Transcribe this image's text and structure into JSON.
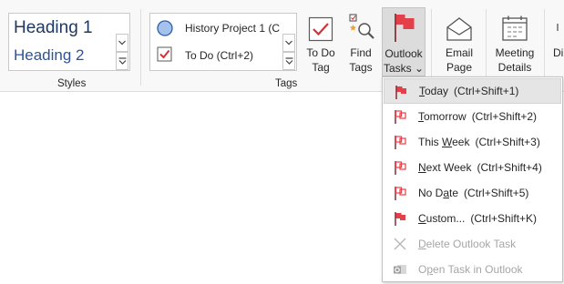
{
  "styles": {
    "heading1": "Heading 1",
    "heading2": "Heading 2",
    "group_label": "Styles"
  },
  "tags": {
    "items": [
      {
        "label": "History Project 1 (C",
        "icon": "circle-icon"
      },
      {
        "label": "To Do (Ctrl+2)",
        "icon": "checkbox-icon"
      }
    ],
    "group_label": "Tags"
  },
  "buttons": {
    "todo_tag": {
      "line1": "To Do",
      "line2": "Tag"
    },
    "find_tags": {
      "line1": "Find",
      "line2": "Tags"
    },
    "outlook_tasks": {
      "line1": "Outlook",
      "line2": "Tasks ⌄"
    },
    "email_page": {
      "line1": "Email",
      "line2": "Page"
    },
    "meeting_details": {
      "line1": "Meeting",
      "line2": "Details"
    },
    "partial": "Di"
  },
  "menu": {
    "items": [
      {
        "pre": "",
        "ul": "T",
        "post": "oday",
        "shortcut": "(Ctrl+Shift+1)",
        "icon": "red-flag-icon",
        "disabled": false
      },
      {
        "pre": "",
        "ul": "T",
        "post": "omorrow",
        "shortcut": "(Ctrl+Shift+2)",
        "icon": "red-flag-icon",
        "disabled": false
      },
      {
        "pre": "This ",
        "ul": "W",
        "post": "eek",
        "shortcut": "(Ctrl+Shift+3)",
        "icon": "red-flag-icon",
        "disabled": false
      },
      {
        "pre": "",
        "ul": "N",
        "post": "ext Week",
        "shortcut": "(Ctrl+Shift+4)",
        "icon": "red-flag-icon",
        "disabled": false
      },
      {
        "pre": "No D",
        "ul": "a",
        "post": "te",
        "shortcut": "(Ctrl+Shift+5)",
        "icon": "red-flag-icon",
        "disabled": false
      },
      {
        "pre": "",
        "ul": "C",
        "post": "ustom...",
        "shortcut": "(Ctrl+Shift+K)",
        "icon": "red-flag-icon",
        "disabled": false
      },
      {
        "pre": "",
        "ul": "D",
        "post": "elete Outlook Task",
        "shortcut": "",
        "icon": "delete-x-icon",
        "disabled": true
      },
      {
        "pre": "O",
        "ul": "p",
        "post": "en Task in Outlook",
        "shortcut": "",
        "icon": "outlook-icon",
        "disabled": true
      }
    ]
  },
  "colors": {
    "flag_red": "#e3404a",
    "accent_blue": "#2f5496",
    "disabled": "#a6a6a6"
  }
}
